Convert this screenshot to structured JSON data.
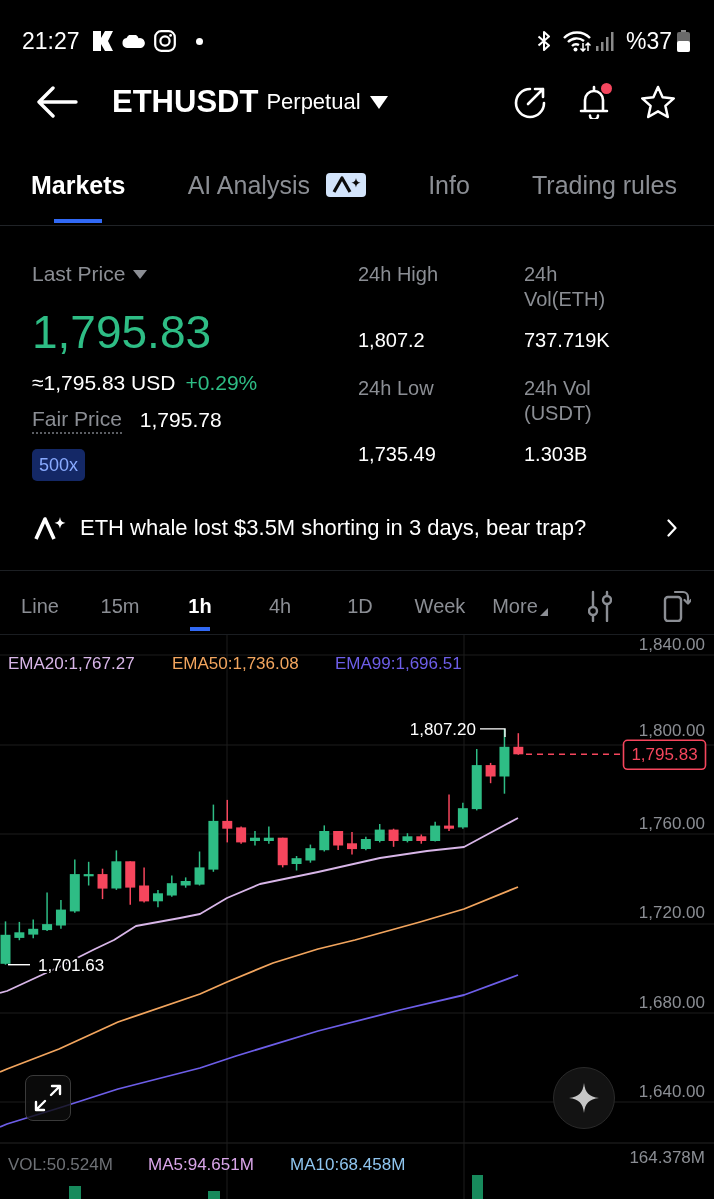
{
  "status_bar": {
    "time": "21:27",
    "battery": "%37"
  },
  "header": {
    "symbol": "ETHUSDT",
    "contract_type": "Perpetual",
    "alert_badge": true,
    "starred": false
  },
  "tabs": [
    {
      "label": "Markets",
      "selected": true,
      "ai_badge": false
    },
    {
      "label": "AI Analysis",
      "selected": false,
      "ai_badge": true
    },
    {
      "label": "Info",
      "selected": false,
      "ai_badge": false
    },
    {
      "label": "Trading rules",
      "selected": false,
      "ai_badge": false
    }
  ],
  "ticker": {
    "price_type": "Last Price",
    "last_price": "1,795.83",
    "usd_value": "≈1,795.83 USD",
    "change": "+0.29%",
    "fair_price_label": "Fair Price",
    "fair_price": "1,795.78",
    "leverage": "500x",
    "stats": [
      {
        "label": "24h High",
        "value": "1,807.2"
      },
      {
        "label": "24h Vol(ETH)",
        "value": "737.719K"
      },
      {
        "label": "24h Low",
        "value": "1,735.49"
      },
      {
        "label": "24h Vol (USDT)",
        "value": "1.303B"
      }
    ]
  },
  "headline": {
    "text": "ETH whale lost $3.5M shorting in 3 days, bear trap?"
  },
  "chart_toolbar": {
    "intervals": [
      {
        "label": "Line",
        "selected": false
      },
      {
        "label": "15m",
        "selected": false
      },
      {
        "label": "1h",
        "selected": true
      },
      {
        "label": "4h",
        "selected": false
      },
      {
        "label": "1D",
        "selected": false
      },
      {
        "label": "Week",
        "selected": false
      }
    ],
    "more": "More"
  },
  "chart": {
    "indicators": [
      {
        "label": "EMA20:1,767.27",
        "color": "#d8b6e8"
      },
      {
        "label": "EMA50:1,736.08",
        "color": "#f2a55e"
      },
      {
        "label": "EMA99:1,696.51",
        "color": "#6d5ee8"
      }
    ],
    "price_axis": [
      "1,840.00",
      "1,800.00",
      "1,760.00",
      "1,720.00",
      "1,680.00",
      "1,640.00"
    ],
    "high_marker": "1,807.20",
    "low_marker": "1,701.63",
    "last_price_tag": "1,795.83"
  },
  "volume": {
    "indicators": [
      {
        "label": "VOL:50.524M",
        "color": "#6e7176"
      },
      {
        "label": "MA5:94.651M",
        "color": "#d9a6e9"
      },
      {
        "label": "MA10:68.458M",
        "color": "#8fc5ef"
      }
    ],
    "axis_max": "164.378M"
  }
}
